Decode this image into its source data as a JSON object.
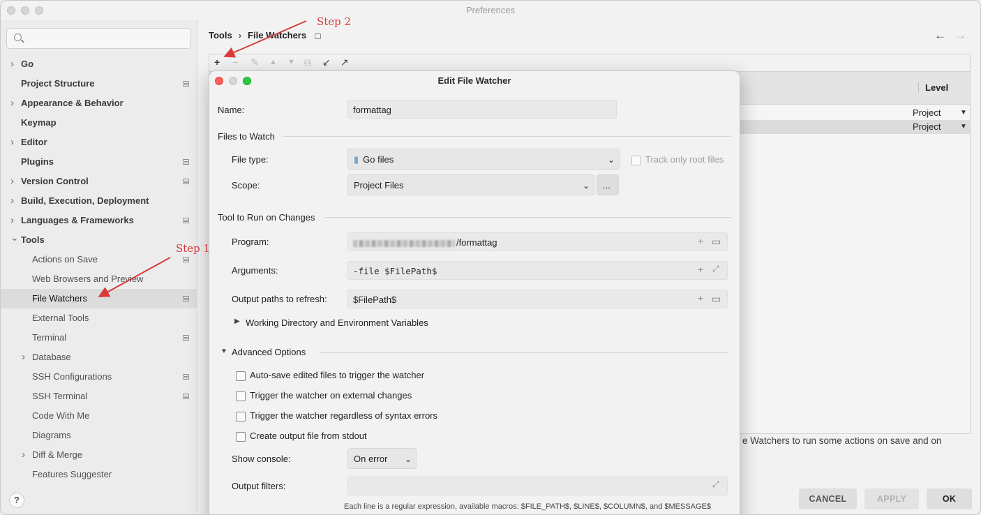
{
  "window": {
    "title": "Preferences"
  },
  "sidebar": {
    "search_placeholder": "",
    "items": [
      {
        "label": "Go",
        "level": "top",
        "chevron": "right",
        "badge": false
      },
      {
        "label": "Project Structure",
        "level": "top",
        "chevron": "",
        "badge": true
      },
      {
        "label": "Appearance & Behavior",
        "level": "top",
        "chevron": "right",
        "badge": false
      },
      {
        "label": "Keymap",
        "level": "top",
        "chevron": "",
        "badge": false
      },
      {
        "label": "Editor",
        "level": "top",
        "chevron": "right",
        "badge": false
      },
      {
        "label": "Plugins",
        "level": "top",
        "chevron": "",
        "badge": true
      },
      {
        "label": "Version Control",
        "level": "top",
        "chevron": "right",
        "badge": true
      },
      {
        "label": "Build, Execution, Deployment",
        "level": "top",
        "chevron": "right",
        "badge": false
      },
      {
        "label": "Languages & Frameworks",
        "level": "top",
        "chevron": "right",
        "badge": true
      },
      {
        "label": "Tools",
        "level": "top",
        "chevron": "down",
        "badge": false
      },
      {
        "label": "Actions on Save",
        "level": "sub",
        "chevron": "",
        "badge": true
      },
      {
        "label": "Web Browsers and Preview",
        "level": "sub",
        "chevron": "",
        "badge": false
      },
      {
        "label": "File Watchers",
        "level": "sub",
        "chevron": "",
        "badge": true,
        "selected": true
      },
      {
        "label": "External Tools",
        "level": "sub",
        "chevron": "",
        "badge": false
      },
      {
        "label": "Terminal",
        "level": "sub",
        "chevron": "",
        "badge": true
      },
      {
        "label": "Database",
        "level": "sub",
        "chevron": "right",
        "badge": false
      },
      {
        "label": "SSH Configurations",
        "level": "sub",
        "chevron": "",
        "badge": true
      },
      {
        "label": "SSH Terminal",
        "level": "sub",
        "chevron": "",
        "badge": true
      },
      {
        "label": "Code With Me",
        "level": "sub",
        "chevron": "",
        "badge": false
      },
      {
        "label": "Diagrams",
        "level": "sub",
        "chevron": "",
        "badge": false
      },
      {
        "label": "Diff & Merge",
        "level": "sub",
        "chevron": "right",
        "badge": false
      },
      {
        "label": "Features Suggester",
        "level": "sub",
        "chevron": "",
        "badge": false
      }
    ],
    "help_label": "?"
  },
  "breadcrumb": {
    "parent": "Tools",
    "separator": "›",
    "current": "File Watchers"
  },
  "nav_arrows": {
    "back": "←",
    "forward": "→"
  },
  "toolbar": {
    "add": "+",
    "remove": "−",
    "edit": "✎",
    "up": "▲",
    "down": "▼",
    "copy": "⧉",
    "import": "↙",
    "export": "↗"
  },
  "table": {
    "level_header": "Level",
    "rows": [
      {
        "level": "Project"
      },
      {
        "level": "Project"
      }
    ],
    "dropdown_glyph": "▼"
  },
  "description_fragment": "e Watchers to run some actions on save and on",
  "buttons": {
    "cancel": "CANCEL",
    "apply": "APPLY",
    "ok": "OK"
  },
  "dialog": {
    "title": "Edit File Watcher",
    "name_label": "Name:",
    "name_value": "formattag",
    "files_section": "Files to Watch",
    "file_type_label": "File type:",
    "file_type_value": "Go files",
    "track_root_label": "Track only root files",
    "scope_label": "Scope:",
    "scope_value": "Project Files",
    "scope_more": "...",
    "tool_section": "Tool to Run on Changes",
    "program_label": "Program:",
    "program_value": "/formattag",
    "arguments_label": "Arguments:",
    "arguments_value": "-file $FilePath$",
    "output_paths_label": "Output paths to refresh:",
    "output_paths_value": "$FilePath$",
    "working_dir_label": "Working Directory and Environment Variables",
    "advanced_section": "Advanced Options",
    "checkboxes": [
      "Auto-save edited files to trigger the watcher",
      "Trigger the watcher on external changes",
      "Trigger the watcher regardless of syntax errors",
      "Create output file from stdout"
    ],
    "show_console_label": "Show console:",
    "show_console_value": "On error",
    "output_filters_label": "Output filters:",
    "output_filters_value": "",
    "hint": "Each line is a regular expression, available macros: $FILE_PATH$, $LINE$, $COLUMN$, and $MESSAGE$"
  },
  "annotations": {
    "step1": "Step 1",
    "step2": "Step 2"
  },
  "colors": {
    "accent_red": "#d83a3a",
    "close": "#fe5f57",
    "minimize": "#d6d6d6",
    "zoom": "#28c840"
  }
}
